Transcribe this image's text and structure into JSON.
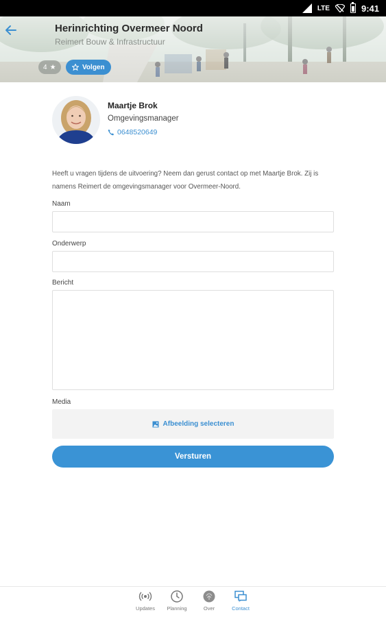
{
  "status_bar": {
    "network": "LTE",
    "time": "9:41"
  },
  "header": {
    "title": "Herinrichting Overmeer Noord",
    "subtitle": "Reimert Bouw & Infrastructuur",
    "star_count": "4",
    "follow_label": "Volgen"
  },
  "contact": {
    "name": "Maartje Brok",
    "role": "Omgevingsmanager",
    "phone": "0648520649"
  },
  "intro_text": "Heeft u vragen tijdens de uitvoering? Neem dan gerust contact op met Maartje Brok. Zij is namens Reimert de omgevingsmanager voor Overmeer-Noord.",
  "form": {
    "name_label": "Naam",
    "name_value": "",
    "subject_label": "Onderwerp",
    "subject_value": "",
    "message_label": "Bericht",
    "message_value": "",
    "media_label": "Media",
    "media_button": "Afbeelding selecteren",
    "submit_label": "Versturen"
  },
  "bottom_nav": {
    "items": [
      {
        "label": "Updates",
        "icon": "broadcast-icon",
        "active": false
      },
      {
        "label": "Planning",
        "icon": "clock-icon",
        "active": false
      },
      {
        "label": "Over",
        "icon": "fingerprint-icon",
        "active": false
      },
      {
        "label": "Contact",
        "icon": "chat-icon",
        "active": true
      }
    ]
  },
  "colors": {
    "accent": "#3b8fd1",
    "text": "#333333",
    "muted": "#8a8f8a",
    "field_border": "#dedede",
    "media_bg": "#f3f3f3"
  }
}
